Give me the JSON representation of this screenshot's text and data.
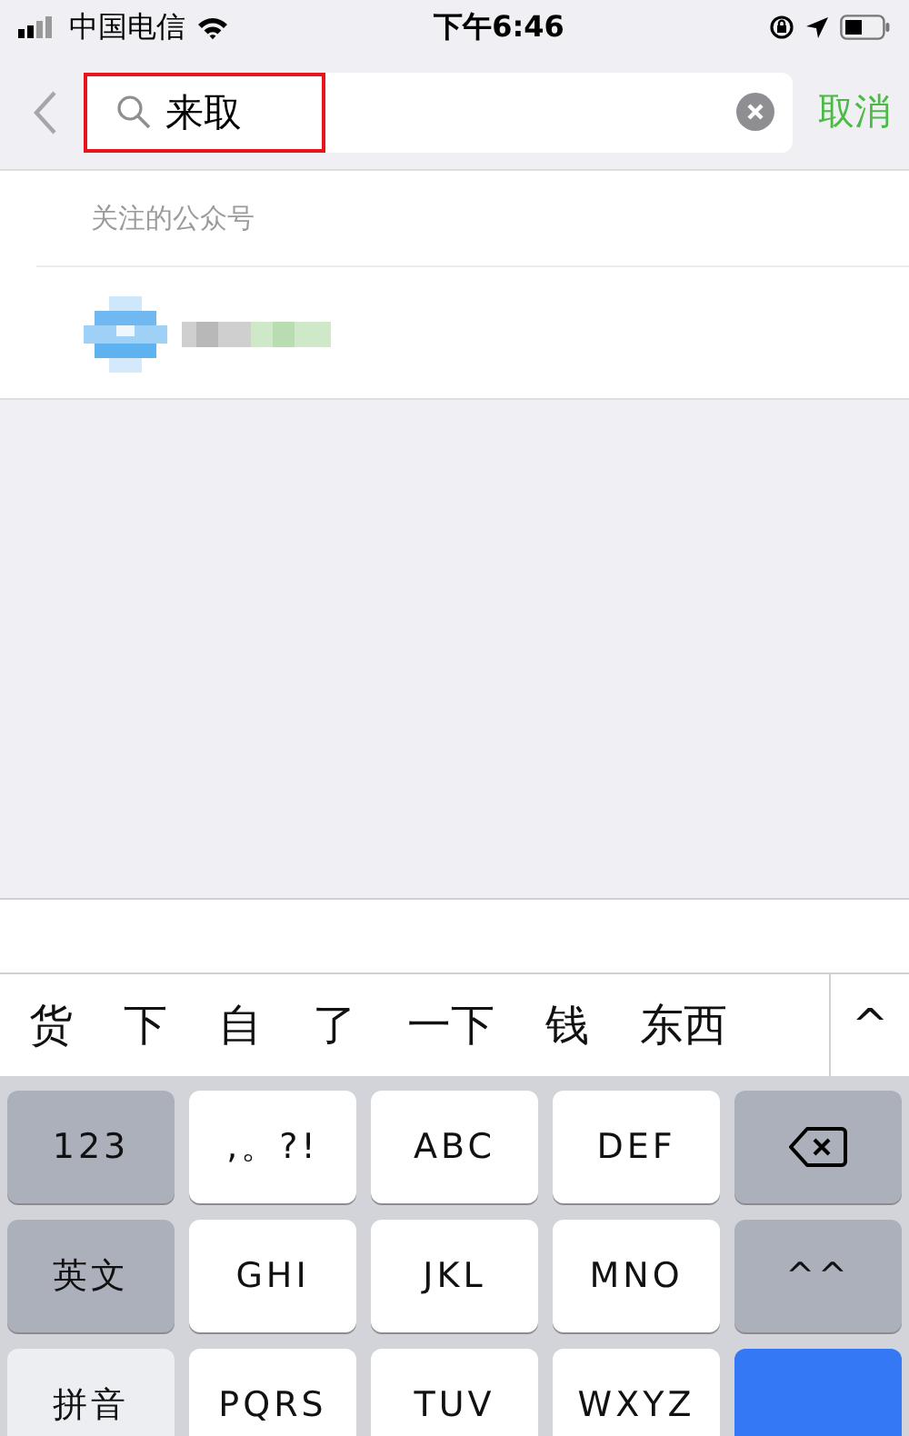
{
  "status_bar": {
    "carrier": "中国电信",
    "time": "下午6:46"
  },
  "search": {
    "query": "来取",
    "highlighted": true,
    "cancel": "取消"
  },
  "section": {
    "title": "关注的公众号"
  },
  "candidates": {
    "words": [
      "货",
      "下",
      "自",
      "了",
      "一下",
      "钱",
      "东西"
    ],
    "expand": "^"
  },
  "keyboard": {
    "rows": [
      [
        {
          "kind": "function",
          "label": "123"
        },
        {
          "kind": "letter",
          "label": ",。?!"
        },
        {
          "kind": "letter",
          "label": "ABC"
        },
        {
          "kind": "letter",
          "label": "DEF"
        },
        {
          "kind": "backspace"
        }
      ],
      [
        {
          "kind": "function",
          "label": "英文"
        },
        {
          "kind": "letter",
          "label": "GHI"
        },
        {
          "kind": "letter",
          "label": "JKL"
        },
        {
          "kind": "letter",
          "label": "MNO"
        },
        {
          "kind": "function",
          "label": "^^"
        }
      ],
      [
        {
          "kind": "light",
          "label": "拼音"
        },
        {
          "kind": "letter",
          "label": "PQRS"
        },
        {
          "kind": "letter",
          "label": "TUV"
        },
        {
          "kind": "letter",
          "label": "WXYZ"
        },
        {
          "kind": "action"
        }
      ]
    ]
  }
}
